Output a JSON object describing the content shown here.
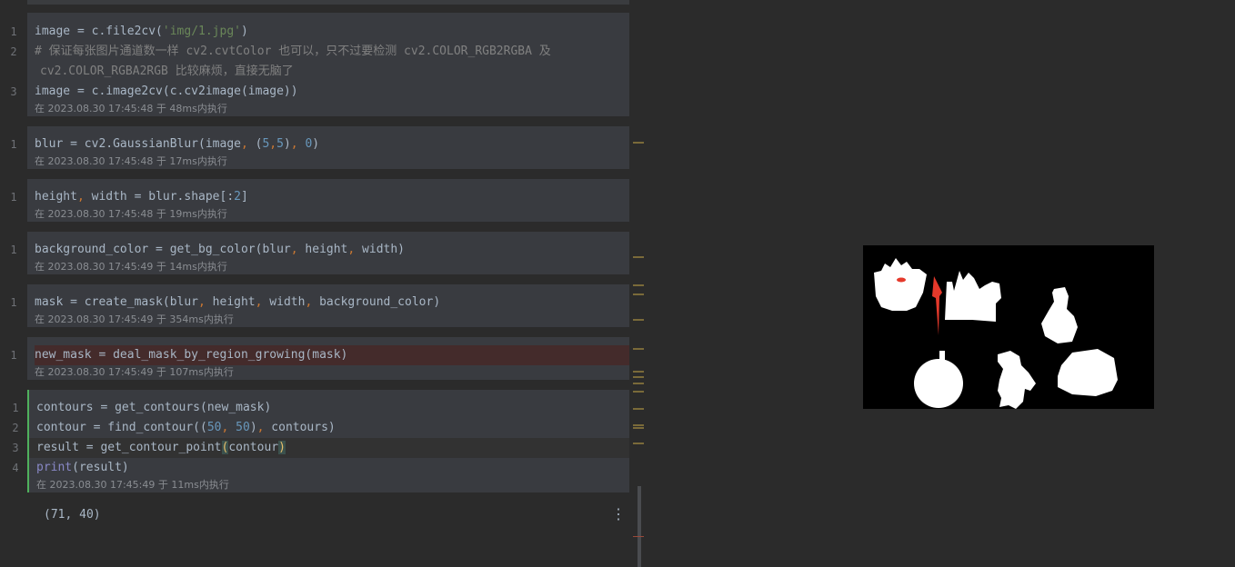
{
  "cells": [
    {
      "lines": [
        {
          "n": "1",
          "code": "image = c.file2cv('img/1.jpg')"
        },
        {
          "n": "2",
          "code": "# 保证每张图片通道数一样 cv2.cvtColor 也可以，只不过要检测 cv2.COLOR_RGB2RGBA 及"
        },
        {
          "n": "",
          "code": "cv2.COLOR_RGBA2RGB 比较麻烦，直接无脑了"
        },
        {
          "n": "3",
          "code": "image = c.image2cv(c.cv2image(image))"
        }
      ],
      "meta": "在 2023.08.30 17:45:48 于 48ms内执行"
    },
    {
      "lines": [
        {
          "n": "1",
          "code": "blur = cv2.GaussianBlur(image, (5,5), 0)"
        }
      ],
      "meta": "在 2023.08.30 17:45:48 于 17ms内执行"
    },
    {
      "lines": [
        {
          "n": "1",
          "code": "height, width = blur.shape[:2]"
        }
      ],
      "meta": "在 2023.08.30 17:45:48 于 19ms内执行"
    },
    {
      "lines": [
        {
          "n": "1",
          "code": "background_color = get_bg_color(blur, height, width)"
        }
      ],
      "meta": "在 2023.08.30 17:45:49 于 14ms内执行"
    },
    {
      "lines": [
        {
          "n": "1",
          "code": "mask = create_mask(blur, height, width, background_color)"
        }
      ],
      "meta": "在 2023.08.30 17:45:49 于 354ms内执行"
    },
    {
      "lines": [
        {
          "n": "1",
          "code": "new_mask = deal_mask_by_region_growing(mask)"
        }
      ],
      "meta": "在 2023.08.30 17:45:49 于 107ms内执行"
    },
    {
      "lines": [
        {
          "n": "1",
          "code": "contours = get_contours(new_mask)"
        },
        {
          "n": "2",
          "code": "contour = find_contour((50, 50), contours)"
        },
        {
          "n": "3",
          "code": "result = get_contour_point(contour)"
        },
        {
          "n": "4",
          "code": "print(result)"
        }
      ],
      "meta": "在 2023.08.30 17:45:49 于 11ms内执行"
    }
  ],
  "output": "(71, 40)",
  "more_icon": "vertical-ellipsis-icon",
  "colors": {
    "accent": "#4fb15d",
    "string": "#6a8759",
    "number": "#6897bb",
    "keyword": "#cc7832"
  }
}
